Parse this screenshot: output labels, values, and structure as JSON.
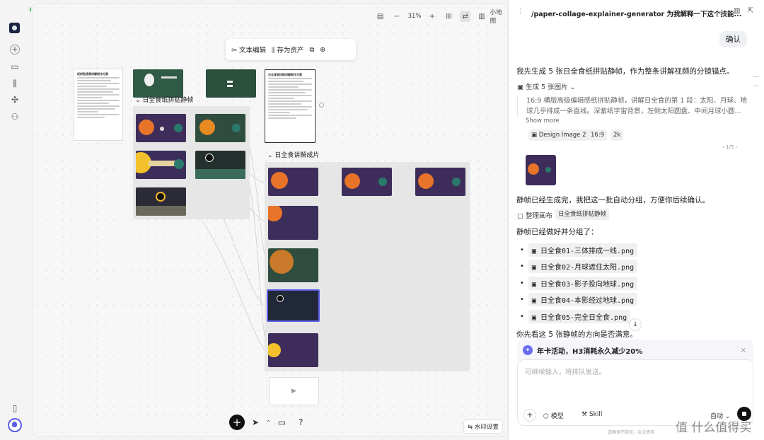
{
  "toolbar": {
    "zoom": "31%",
    "minimap_label": "小地图"
  },
  "floatbar": {
    "text_edit": "文本编辑",
    "save_asset": "存为资产"
  },
  "canvas": {
    "group1_title": "日全食纸拼贴静帧",
    "group2_title": "日全食讲解成片",
    "doc_title": "纸拼贴视频讲解制作方案",
    "doc2_title": "日全食纸拼贴讲解制作方案"
  },
  "bottom": {
    "watermark": "水印设置"
  },
  "panel": {
    "title": "/paper-collage-explainer-generator 为我解释一下这个技能...",
    "user_msg": "确认",
    "msg1": "我先生成 5 张日全食纸拼贴静帧，作为整条讲解视频的分镜锚点。",
    "gen_label": "生成 5 张图片",
    "gen_desc": "16:9 横版高级编辑感纸拼贴静帧，讲解日全食的第 1 段：太阳、月球、地球几乎排成一条直线。深紫纸宇宙背景，左侧太阳圆盘、中间月球小圆...",
    "show_more": "Show more",
    "model_chip": "Design Image 2",
    "ratio_chip": "16:9",
    "res_chip": "2k",
    "pager": "1/5",
    "msg2": "静帧已经生成完，我把这一批自动分组，方便你后续确认。",
    "organize_label": "整理画布",
    "organize_chip": "日全食纸拼贴静帧",
    "msg3": "静帧已经做好并分组了：",
    "files": [
      "日全食01-三体排成一线.png",
      "日全食02-月球遮住太阳.png",
      "日全食03-影子投向地球.png",
      "日全食04-本影经过地球.png",
      "日全食05-完全日全食.png"
    ],
    "msg4": "你先看这 5 张静帧的方向是否满意。",
    "promo": "年卡活动，H3消耗永久减少20%",
    "input_placeholder": "可继续输入，将排队发送。",
    "model_btn": "模型",
    "skill_btn": "Skill",
    "auto_btn": "自动",
    "footer": "请确保不拔权，合法使用"
  },
  "brand": "值 什么值得买"
}
